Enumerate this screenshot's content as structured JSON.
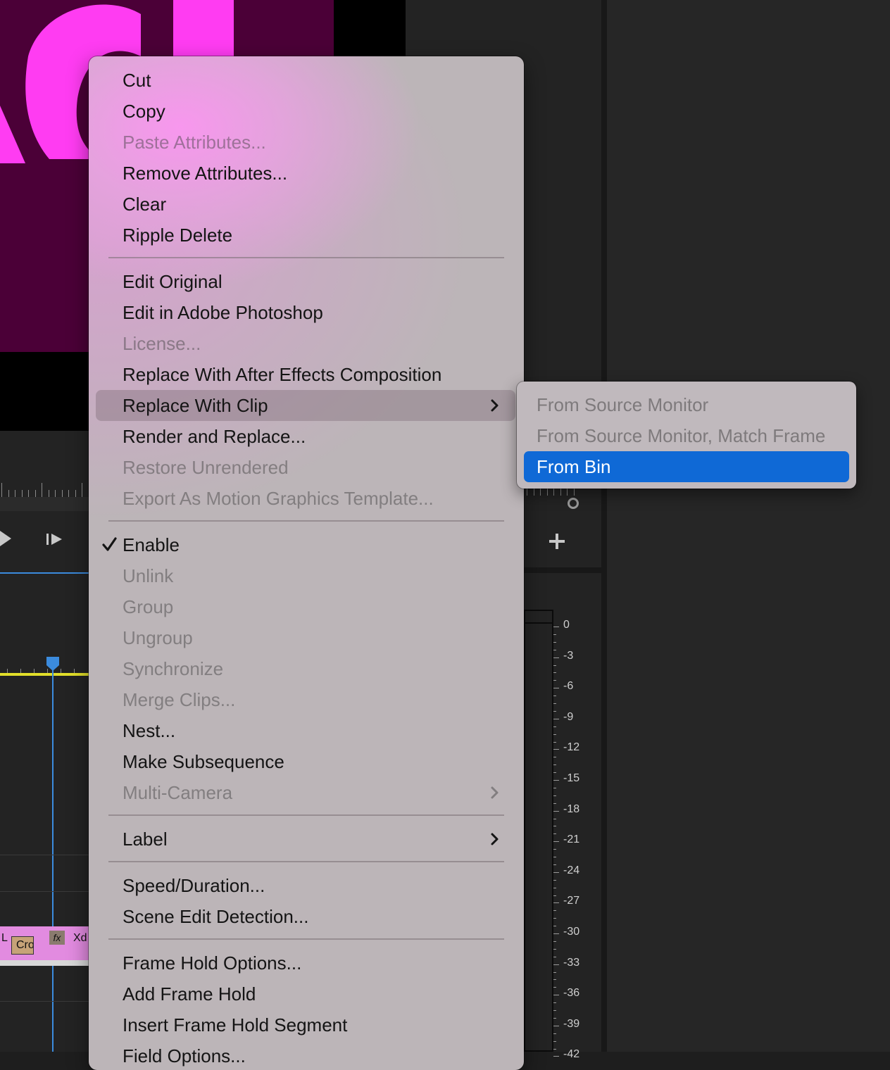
{
  "context_menu": {
    "groups": [
      {
        "items": [
          {
            "label": "Cut",
            "enabled": true
          },
          {
            "label": "Copy",
            "enabled": true
          },
          {
            "label": "Paste Attributes...",
            "enabled": false
          },
          {
            "label": "Remove Attributes...",
            "enabled": true
          },
          {
            "label": "Clear",
            "enabled": true
          },
          {
            "label": "Ripple Delete",
            "enabled": true
          }
        ]
      },
      {
        "items": [
          {
            "label": "Edit Original",
            "enabled": true
          },
          {
            "label": "Edit in Adobe Photoshop",
            "enabled": true
          },
          {
            "label": "License...",
            "enabled": false
          },
          {
            "label": "Replace With After Effects Composition",
            "enabled": true
          },
          {
            "label": "Replace With Clip",
            "enabled": true,
            "submenu": true,
            "highlighted": true
          },
          {
            "label": "Render and Replace...",
            "enabled": true
          },
          {
            "label": "Restore Unrendered",
            "enabled": false
          },
          {
            "label": "Export As Motion Graphics Template...",
            "enabled": false
          }
        ]
      },
      {
        "items": [
          {
            "label": "Enable",
            "enabled": true,
            "checked": true
          },
          {
            "label": "Unlink",
            "enabled": false
          },
          {
            "label": "Group",
            "enabled": false
          },
          {
            "label": "Ungroup",
            "enabled": false
          },
          {
            "label": "Synchronize",
            "enabled": false
          },
          {
            "label": "Merge Clips...",
            "enabled": false
          },
          {
            "label": "Nest...",
            "enabled": true
          },
          {
            "label": "Make Subsequence",
            "enabled": true
          },
          {
            "label": "Multi-Camera",
            "enabled": false,
            "submenu": true
          }
        ]
      },
      {
        "items": [
          {
            "label": "Label",
            "enabled": true,
            "submenu": true
          }
        ]
      },
      {
        "items": [
          {
            "label": "Speed/Duration...",
            "enabled": true
          },
          {
            "label": "Scene Edit Detection...",
            "enabled": true
          }
        ]
      },
      {
        "items": [
          {
            "label": "Frame Hold Options...",
            "enabled": true
          },
          {
            "label": "Add Frame Hold",
            "enabled": true
          },
          {
            "label": "Insert Frame Hold Segment",
            "enabled": true
          },
          {
            "label": "Field Options...",
            "enabled": true
          }
        ]
      }
    ]
  },
  "submenu": {
    "items": [
      {
        "label": "From Source Monitor",
        "enabled": false
      },
      {
        "label": "From Source Monitor, Match Frame",
        "enabled": false
      },
      {
        "label": "From Bin",
        "enabled": true,
        "selected": true
      }
    ]
  },
  "timeline": {
    "clip_label_l": "L",
    "clip_label_cro": "Cro",
    "fx_badge": "fx",
    "clip_label_xd": "Xd"
  },
  "audio_meter": {
    "scale_labels": [
      "0",
      "-3",
      "-6",
      "-9",
      "-12",
      "-15",
      "-18",
      "-21",
      "-24",
      "-27",
      "-30",
      "-33",
      "-36",
      "-39",
      "-42"
    ]
  },
  "colors": {
    "selection_blue": "#0f69d6",
    "clip_pink": "#e28be0",
    "work_area_yellow": "#e2df2a",
    "playhead_blue": "#3b8bdd",
    "preview_magenta": "#ff3cf2"
  }
}
